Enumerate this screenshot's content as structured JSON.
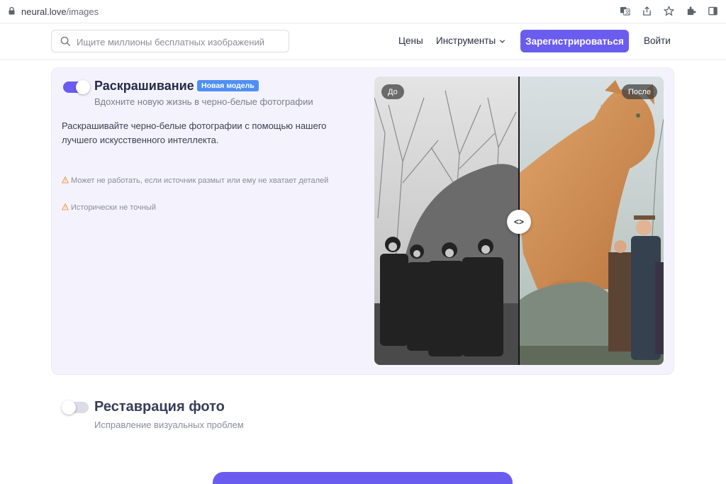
{
  "browser": {
    "domain": "neural.love",
    "path": "/images"
  },
  "header": {
    "search_placeholder": "Ищите миллионы бесплатных изображений",
    "prices": "Цены",
    "tools": "Инструменты",
    "register": "Зарегистрироваться",
    "login": "Войти"
  },
  "feature_colorize": {
    "enabled": true,
    "title": "Раскрашивание",
    "badge": "Новая модель",
    "subtitle": "Вдохните новую жизнь в черно-белые фотографии",
    "description": "Раскрашивайте черно-белые фотографии с помощью нашего лучшего искусственного интеллекта.",
    "warnings": [
      "Может не работать, если источник размыт или ему не хватает деталей",
      "Исторически не точный"
    ],
    "compare": {
      "before_label": "До",
      "after_label": "После",
      "handle": "<>"
    }
  },
  "feature_restore": {
    "enabled": false,
    "title": "Реставрация фото",
    "subtitle": "Исправление визуальных проблем"
  },
  "colors": {
    "accent": "#6b5cf0",
    "badge": "#4f8ff5",
    "card_bg": "#f4f3fd",
    "warning": "#f0a050"
  }
}
